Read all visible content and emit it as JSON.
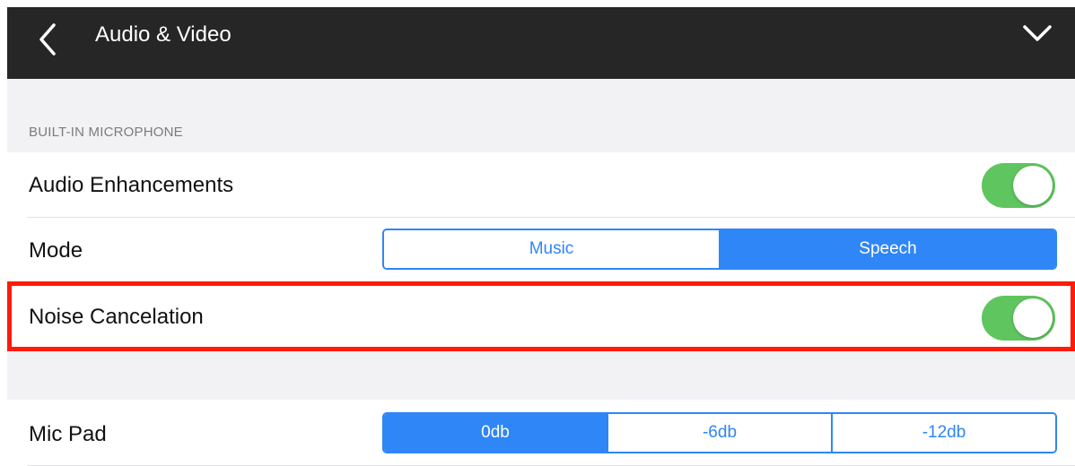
{
  "header": {
    "title": "Audio & Video",
    "back_icon": "chevron-left-icon",
    "collapse_icon": "chevron-down-icon"
  },
  "section": {
    "header": "BUILT-IN MICROPHONE"
  },
  "rows": {
    "audio_enhancements": {
      "label": "Audio Enhancements",
      "toggle_on": true
    },
    "mode": {
      "label": "Mode",
      "options": [
        "Music",
        "Speech"
      ],
      "selected": "Speech"
    },
    "noise_cancelation": {
      "label": "Noise Cancelation",
      "toggle_on": true
    },
    "mic_pad": {
      "label": "Mic Pad",
      "options": [
        "0db",
        "-6db",
        "-12db"
      ],
      "selected": "0db"
    }
  },
  "colors": {
    "header_bg": "#262626",
    "accent": "#2f86f6",
    "toggle_on": "#5fc55e",
    "group_bg": "#f2f2f4",
    "highlight": "#ff1a0a"
  }
}
